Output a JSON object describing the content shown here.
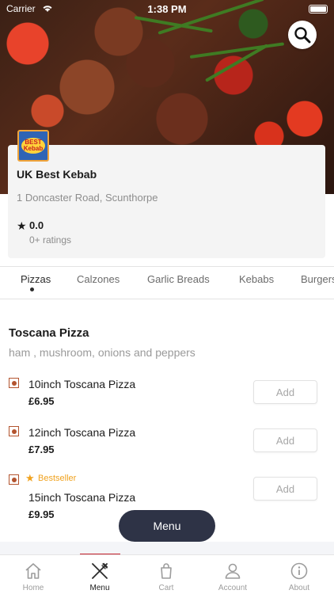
{
  "status_bar": {
    "carrier": "Carrier",
    "time": "1:38 PM"
  },
  "restaurant": {
    "name": "UK Best Kebab",
    "address": "1 Doncaster Road, Scunthorpe",
    "rating": "0.0",
    "ratings_count": "0+ ratings",
    "logo_text": "BEST Kebab"
  },
  "categories": [
    {
      "label": "Pizzas",
      "active": true
    },
    {
      "label": "Calzones",
      "active": false
    },
    {
      "label": "Garlic Breads",
      "active": false
    },
    {
      "label": "Kebabs",
      "active": false
    },
    {
      "label": "Burgers",
      "active": false
    }
  ],
  "section": {
    "title": "Toscana Pizza",
    "description": "ham , mushroom, onions and peppers",
    "items": [
      {
        "name": "10inch Toscana Pizza",
        "price": "£6.95",
        "add_label": "Add"
      },
      {
        "name": "12inch Toscana Pizza",
        "price": "£7.95",
        "add_label": "Add"
      },
      {
        "name": "15inch Toscana Pizza",
        "price": "£9.95",
        "add_label": "Add",
        "badge": "Bestseller"
      }
    ]
  },
  "menu_button": "Menu",
  "tabbar": [
    {
      "label": "Home",
      "icon": "home-icon"
    },
    {
      "label": "Menu",
      "icon": "cutlery-icon",
      "active": true
    },
    {
      "label": "Cart",
      "icon": "bag-icon"
    },
    {
      "label": "Account",
      "icon": "person-icon"
    },
    {
      "label": "About",
      "icon": "info-icon"
    }
  ],
  "colors": {
    "accent": "#c4202c",
    "fab": "#2e3346",
    "bestseller": "#f0a21e",
    "veg_mark": "#b3542f"
  }
}
